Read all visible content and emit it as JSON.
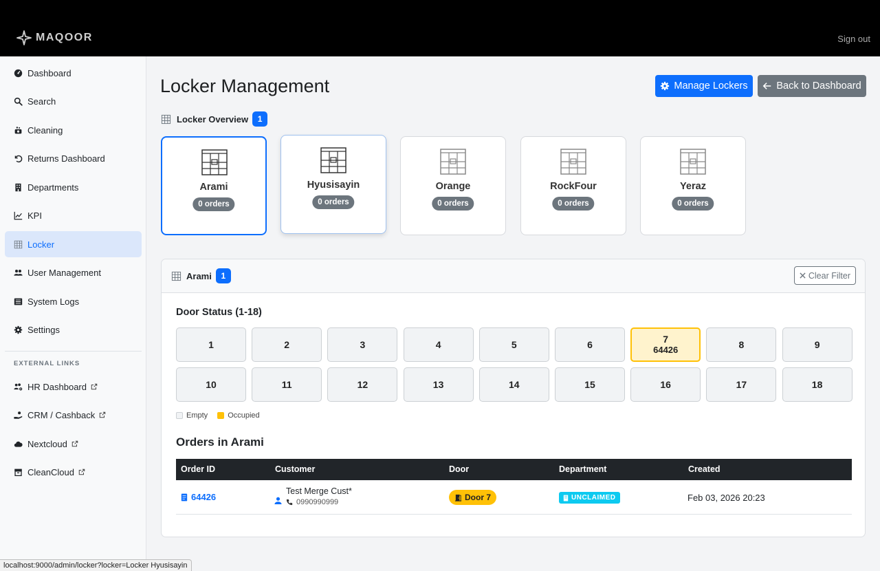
{
  "app": {
    "brand": "MAQOOR",
    "sign_out": "Sign out",
    "status_url": "localhost:9000/admin/locker?locker=Locker Hyusisayin"
  },
  "sidebar": {
    "items": [
      {
        "label": "Dashboard",
        "icon": "dashboard-icon"
      },
      {
        "label": "Search",
        "icon": "search-icon"
      },
      {
        "label": "Cleaning",
        "icon": "cleaning-icon"
      },
      {
        "label": "Returns Dashboard",
        "icon": "undo-icon"
      },
      {
        "label": "Departments",
        "icon": "building-icon"
      },
      {
        "label": "KPI",
        "icon": "chart-line-icon"
      },
      {
        "label": "Locker",
        "icon": "locker-icon",
        "active": true
      },
      {
        "label": "User Management",
        "icon": "users-icon"
      },
      {
        "label": "System Logs",
        "icon": "list-icon"
      },
      {
        "label": "Settings",
        "icon": "gear-icon"
      }
    ],
    "external_heading": "EXTERNAL LINKS",
    "external": [
      {
        "label": "HR Dashboard",
        "icon": "users-gear-icon"
      },
      {
        "label": "CRM / Cashback",
        "icon": "hand-coins-icon"
      },
      {
        "label": "Nextcloud",
        "icon": "cloud-icon"
      },
      {
        "label": "CleanCloud",
        "icon": "box-icon"
      }
    ]
  },
  "page": {
    "title": "Locker Management",
    "manage_button": "Manage Lockers",
    "back_button": "Back to Dashboard",
    "overview_label": "Locker Overview",
    "overview_count": "1"
  },
  "lockers": [
    {
      "name": "Arami",
      "orders": "0 orders"
    },
    {
      "name": "Hyusisayin",
      "orders": "0 orders"
    },
    {
      "name": "Orange",
      "orders": "0 orders"
    },
    {
      "name": "RockFour",
      "orders": "0 orders"
    },
    {
      "name": "Yeraz",
      "orders": "0 orders"
    }
  ],
  "detail": {
    "locker_name": "Arami",
    "count": "1",
    "clear_filter": "Clear Filter",
    "door_title": "Door Status (1-18)",
    "doors": [
      {
        "num": "1"
      },
      {
        "num": "2"
      },
      {
        "num": "3"
      },
      {
        "num": "4"
      },
      {
        "num": "5"
      },
      {
        "num": "6"
      },
      {
        "num": "7",
        "order": "64426",
        "occupied": true
      },
      {
        "num": "8"
      },
      {
        "num": "9"
      },
      {
        "num": "10"
      },
      {
        "num": "11"
      },
      {
        "num": "12"
      },
      {
        "num": "13"
      },
      {
        "num": "14"
      },
      {
        "num": "15"
      },
      {
        "num": "16"
      },
      {
        "num": "17"
      },
      {
        "num": "18"
      }
    ],
    "legend_empty": "Empty",
    "legend_occupied": "Occupied",
    "orders_title": "Orders in Arami",
    "columns": [
      "Order ID",
      "Customer",
      "Door",
      "Department",
      "Created"
    ],
    "rows": [
      {
        "order_id": "64426",
        "customer": "Test Merge Cust*",
        "phone": "0990990999",
        "door": "Door 7",
        "department": "UNCLAIMED",
        "created": "Feb 03, 2026 20:23"
      }
    ]
  },
  "colors": {
    "primary": "#0d6efd",
    "secondary": "#6c757d",
    "warning": "#ffc107",
    "info": "#0dcaf0",
    "dark": "#212529"
  }
}
